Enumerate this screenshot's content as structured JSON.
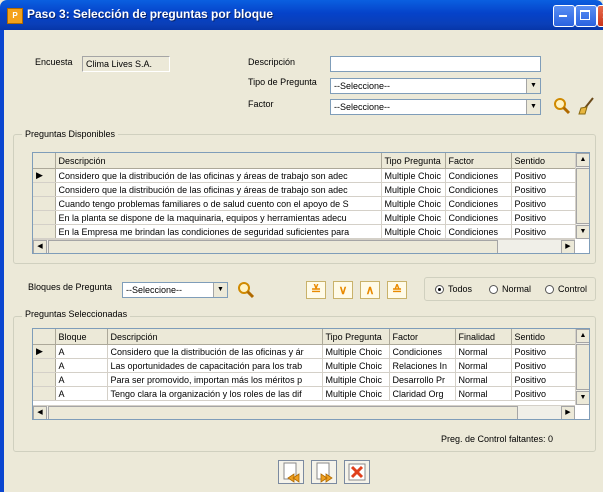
{
  "window": {
    "title": "Paso 3: Selección de preguntas por bloque",
    "title_icon": "app-icon"
  },
  "filters": {
    "encuesta_label": "Encuesta",
    "encuesta_value": "Clima Lives S.A.",
    "descripcion_label": "Descripción",
    "descripcion_value": "",
    "tipo_label": "Tipo de Pregunta",
    "tipo_value": "--Seleccione--",
    "factor_label": "Factor",
    "factor_value": "--Seleccione--"
  },
  "disponibles": {
    "group_title": "Preguntas Disponibles",
    "columns": [
      "Descripción",
      "Tipo Pregunta",
      "Factor",
      "Sentido"
    ],
    "rows": [
      {
        "desc": "Considero que la distribución de las oficinas y áreas de trabajo son adec",
        "tipo": "Multiple Choic",
        "factor": "Condiciones",
        "sentido": "Positivo"
      },
      {
        "desc": "Considero que la distribución de las oficinas y áreas de trabajo son adec",
        "tipo": "Multiple Choic",
        "factor": "Condiciones",
        "sentido": "Positivo"
      },
      {
        "desc": "Cuando tengo problemas familiares o de salud cuento con el apoyo de S",
        "tipo": "Multiple Choic",
        "factor": "Condiciones",
        "sentido": "Positivo"
      },
      {
        "desc": "En la planta se dispone de la maquinaria, equipos y herramientas adecu",
        "tipo": "Multiple Choic",
        "factor": "Condiciones",
        "sentido": "Positivo"
      },
      {
        "desc": "En la Empresa me brindan las condiciones de seguridad suficientes para",
        "tipo": "Multiple Choic",
        "factor": "Condiciones",
        "sentido": "Positivo"
      }
    ]
  },
  "bloques": {
    "label": "Bloques de Pregunta",
    "value": "--Seleccione--",
    "radios": [
      {
        "label": "Todos",
        "checked": true
      },
      {
        "label": "Normal",
        "checked": false
      },
      {
        "label": "Control",
        "checked": false
      }
    ]
  },
  "seleccionadas": {
    "group_title": "Preguntas Seleccionadas",
    "columns": [
      "Bloque",
      "Descripción",
      "Tipo Pregunta",
      "Factor",
      "Finalidad",
      "Sentido"
    ],
    "rows": [
      {
        "bloque": "A",
        "desc": "Considero que la distribución de las oficinas y ár",
        "tipo": "Multiple Choic",
        "factor": "Condiciones",
        "finalidad": "Normal",
        "sentido": "Positivo"
      },
      {
        "bloque": "A",
        "desc": "Las oportunidades de capacitación para los trab",
        "tipo": "Multiple Choic",
        "factor": "Relaciones In",
        "finalidad": "Normal",
        "sentido": "Positivo"
      },
      {
        "bloque": "A",
        "desc": "Para ser promovido, importan más los méritos p",
        "tipo": "Multiple Choic",
        "factor": "Desarrollo Pr",
        "finalidad": "Normal",
        "sentido": "Positivo"
      },
      {
        "bloque": "A",
        "desc": "Tengo clara la organización y los roles de las dif",
        "tipo": "Multiple Choic",
        "factor": "Claridad Org",
        "finalidad": "Normal",
        "sentido": "Positivo"
      }
    ],
    "footer": "Preg. de Control faltantes:  0"
  },
  "icons": {
    "search": "search-icon",
    "clear": "broom-icon",
    "first": "move-all-down-icon",
    "down": "move-down-icon",
    "up": "move-up-icon",
    "last": "move-all-up-icon",
    "back": "back-icon",
    "next": "next-icon",
    "close": "close-icon"
  }
}
